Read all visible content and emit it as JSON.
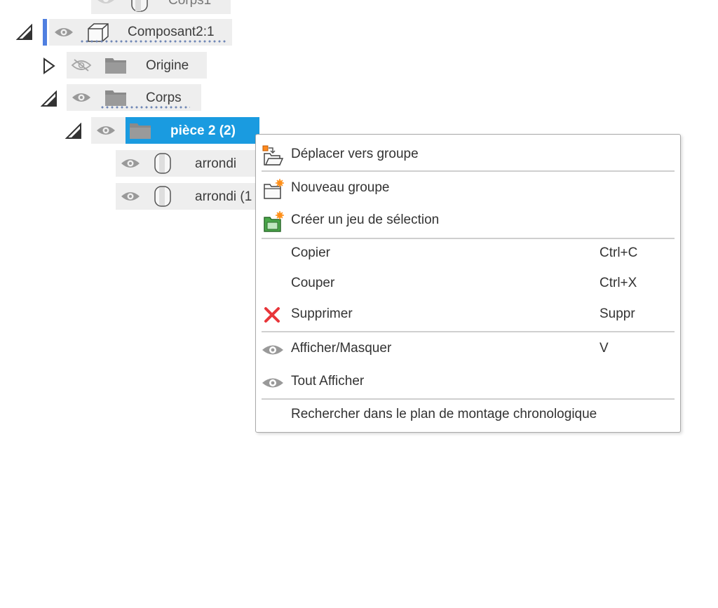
{
  "tree": {
    "top_partial_label": "Corps1",
    "composant_label": "Composant2:1",
    "origine_label": "Origine",
    "corps_label": "Corps",
    "piece_label": "pièce 2 (2)",
    "arrondi1_label": "arrondi",
    "arrondi2_label": "arrondi (1"
  },
  "menu": {
    "move_to_group": "Déplacer vers groupe",
    "new_group": "Nouveau groupe",
    "create_selection_set": "Créer un jeu de sélection",
    "copy": "Copier",
    "copy_shortcut": "Ctrl+C",
    "cut": "Couper",
    "cut_shortcut": "Ctrl+X",
    "delete": "Supprimer",
    "delete_shortcut": "Suppr",
    "show_hide": "Afficher/Masquer",
    "show_hide_shortcut": "V",
    "show_all": "Tout Afficher",
    "find_in_timeline": "Rechercher dans le plan de montage chronologique"
  },
  "colors": {
    "selection": "#1a9be0",
    "accent_bar": "#4f7fe0",
    "delete_icon": "#e8363a"
  }
}
